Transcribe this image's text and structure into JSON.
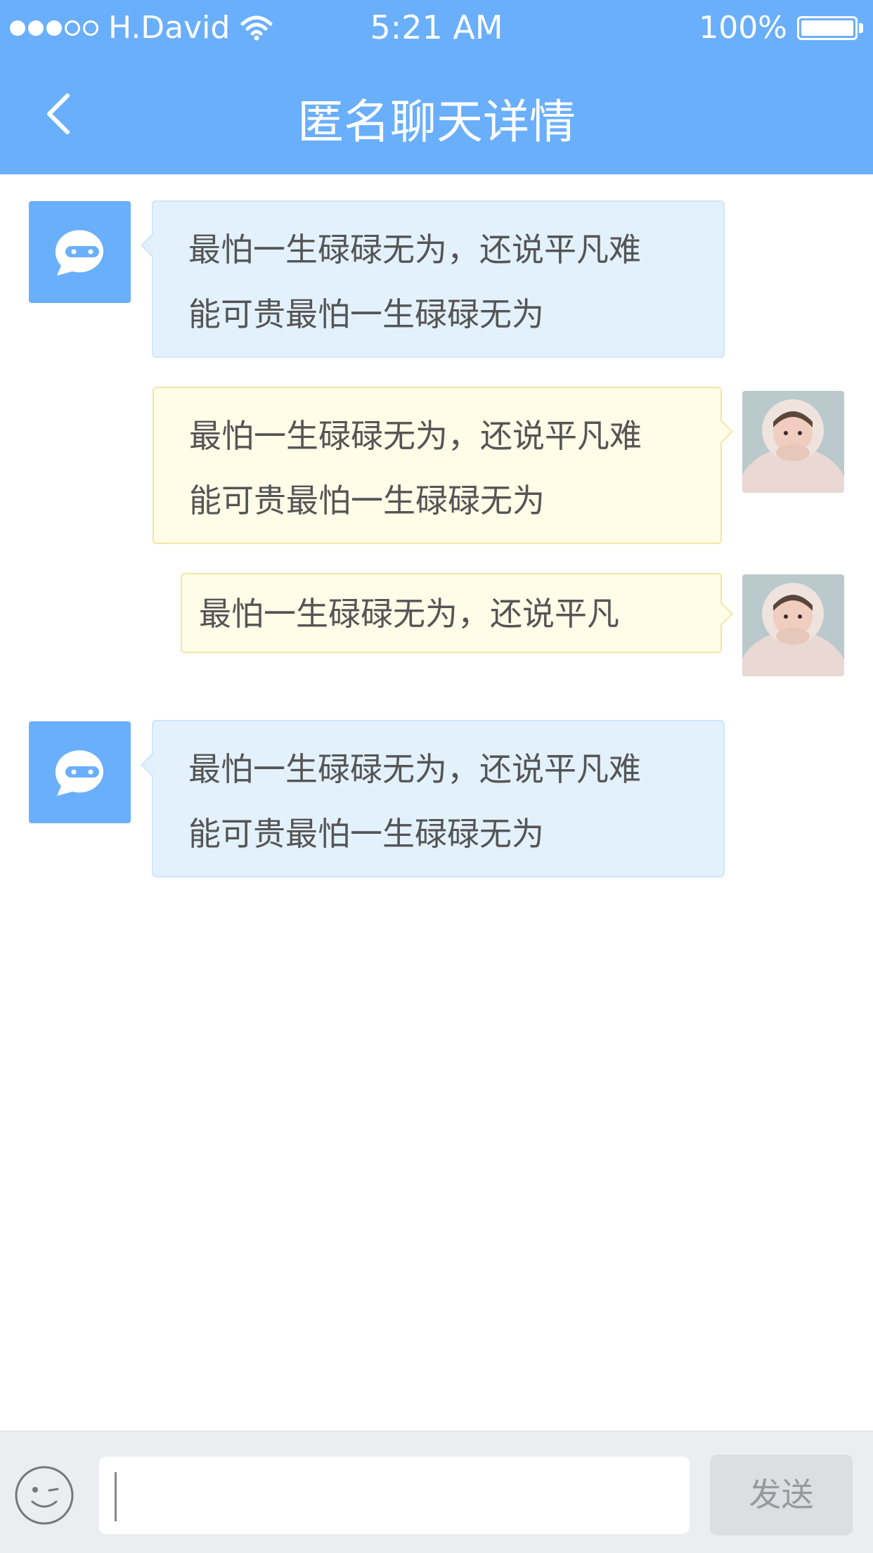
{
  "status_bar": {
    "carrier": "H.David",
    "time": "5:21 AM",
    "battery": "100%"
  },
  "header": {
    "title": "匿名聊天详情"
  },
  "messages": [
    {
      "side": "left",
      "text": "最怕一生碌碌无为，还说平凡难\n能可贵最怕一生碌碌无为"
    },
    {
      "side": "right",
      "text": "最怕一生碌碌无为，还说平凡难\n能可贵最怕一生碌碌无为"
    },
    {
      "side": "right",
      "text": "最怕一生碌碌无为，还说平凡"
    },
    {
      "side": "left",
      "text": "最怕一生碌碌无为，还说平凡难\n能可贵最怕一生碌碌无为"
    }
  ],
  "composer": {
    "input_value": "",
    "send_label": "发送"
  },
  "colors": {
    "accent": "#6aaffb",
    "left_bubble": "#e3f1fd",
    "right_bubble": "#fffce8"
  },
  "icons": [
    "back-chevron-icon",
    "wifi-icon",
    "battery-icon",
    "chat-bot-icon",
    "emoji-icon"
  ]
}
